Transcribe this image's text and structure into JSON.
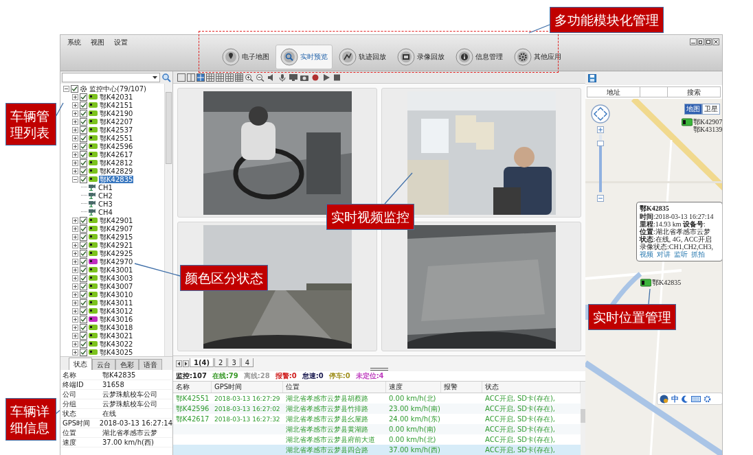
{
  "menu": [
    "系统",
    "视图",
    "设置"
  ],
  "modules": [
    {
      "label": "电子地图",
      "selected": false
    },
    {
      "label": "实时预览",
      "selected": true
    },
    {
      "label": "轨迹回放",
      "selected": false
    },
    {
      "label": "录像回放",
      "selected": false
    },
    {
      "label": "信息管理",
      "selected": false
    },
    {
      "label": "其他应用",
      "selected": false
    }
  ],
  "tree": {
    "label": "监控中心(79/107)",
    "checked": true,
    "expanded": true,
    "children": [
      {
        "label": "鄂K42031",
        "checked": true,
        "expanded": false,
        "selected": false,
        "color": "#7cc21e"
      },
      {
        "label": "鄂K42151",
        "checked": true,
        "expanded": false,
        "selected": false,
        "color": "#7cc21e"
      },
      {
        "label": "鄂K42190",
        "checked": true,
        "expanded": false,
        "selected": false,
        "color": "#7cc21e"
      },
      {
        "label": "鄂K42207",
        "checked": true,
        "expanded": false,
        "selected": false,
        "color": "#7cc21e"
      },
      {
        "label": "鄂K42537",
        "checked": true,
        "expanded": false,
        "selected": false,
        "color": "#7cc21e"
      },
      {
        "label": "鄂K42551",
        "checked": true,
        "expanded": false,
        "selected": false,
        "color": "#7cc21e"
      },
      {
        "label": "鄂K42596",
        "checked": true,
        "expanded": false,
        "selected": false,
        "color": "#7cc21e"
      },
      {
        "label": "鄂K42617",
        "checked": true,
        "expanded": false,
        "selected": false,
        "color": "#7cc21e"
      },
      {
        "label": "鄂K42812",
        "checked": true,
        "expanded": false,
        "selected": false,
        "color": "#7cc21e"
      },
      {
        "label": "鄂K42829",
        "checked": true,
        "expanded": false,
        "selected": false,
        "color": "#7cc21e"
      },
      {
        "label": "鄂K42835",
        "checked": true,
        "expanded": true,
        "selected": true,
        "color": "#7cc21e",
        "children": [
          {
            "label": "CH1"
          },
          {
            "label": "CH2"
          },
          {
            "label": "CH3"
          },
          {
            "label": "CH4"
          }
        ]
      },
      {
        "label": "鄂K42901",
        "checked": true,
        "expanded": false,
        "selected": false,
        "color": "#7cc21e"
      },
      {
        "label": "鄂K42907",
        "checked": true,
        "expanded": false,
        "selected": false,
        "color": "#7cc21e"
      },
      {
        "label": "鄂K42915",
        "checked": true,
        "expanded": false,
        "selected": false,
        "color": "#7cc21e"
      },
      {
        "label": "鄂K42921",
        "checked": true,
        "expanded": false,
        "selected": false,
        "color": "#7cc21e"
      },
      {
        "label": "鄂K42925",
        "checked": true,
        "expanded": false,
        "selected": false,
        "color": "#7cc21e"
      },
      {
        "label": "鄂K42970",
        "checked": true,
        "expanded": false,
        "selected": false,
        "color": "#c02ec0"
      },
      {
        "label": "鄂K43001",
        "checked": true,
        "expanded": false,
        "selected": false,
        "color": "#7cc21e"
      },
      {
        "label": "鄂K43003",
        "checked": true,
        "expanded": false,
        "selected": false,
        "color": "#7cc21e"
      },
      {
        "label": "鄂K43007",
        "checked": true,
        "expanded": false,
        "selected": false,
        "color": "#7cc21e"
      },
      {
        "label": "鄂K43010",
        "checked": true,
        "expanded": false,
        "selected": false,
        "color": "#7cc21e"
      },
      {
        "label": "鄂K43011",
        "checked": true,
        "expanded": false,
        "selected": false,
        "color": "#7cc21e"
      },
      {
        "label": "鄂K43012",
        "checked": true,
        "expanded": false,
        "selected": false,
        "color": "#7cc21e"
      },
      {
        "label": "鄂K43016",
        "checked": true,
        "expanded": false,
        "selected": false,
        "color": "#c02ec0"
      },
      {
        "label": "鄂K43018",
        "checked": true,
        "expanded": false,
        "selected": false,
        "color": "#7cc21e"
      },
      {
        "label": "鄂K43021",
        "checked": true,
        "expanded": false,
        "selected": false,
        "color": "#7cc21e"
      },
      {
        "label": "鄂K43022",
        "checked": true,
        "expanded": false,
        "selected": false,
        "color": "#7cc21e"
      },
      {
        "label": "鄂K43025",
        "checked": true,
        "expanded": false,
        "selected": false,
        "color": "#7cc21e"
      }
    ]
  },
  "detail_tabs": [
    {
      "label": "状态",
      "selected": true
    },
    {
      "label": "云台",
      "selected": false
    },
    {
      "label": "色彩",
      "selected": false
    },
    {
      "label": "语音",
      "selected": false
    }
  ],
  "detail_rows": [
    {
      "label": "名称",
      "value": "鄂K42835"
    },
    {
      "label": "终端ID",
      "value": "31658"
    },
    {
      "label": "公司",
      "value": "云梦珠航校车公司"
    },
    {
      "label": "分组",
      "value": "云梦珠航校车公司"
    },
    {
      "label": "状态",
      "value": "在线"
    },
    {
      "label": "GPS时间",
      "value": "2018-03-13 16:27:14"
    },
    {
      "label": "位置",
      "value": "湖北省孝感市云梦"
    },
    {
      "label": "速度",
      "value": "37.00 km/h(西)"
    }
  ],
  "video_tiles": [
    {
      "kind": "picture"
    },
    {
      "kind": "picture"
    },
    {
      "kind": "picture"
    },
    {
      "kind": "picture"
    }
  ],
  "page_tabs": [
    {
      "label": "1(4)",
      "selected": true
    },
    {
      "label": "2",
      "selected": false
    },
    {
      "label": "3",
      "selected": false
    },
    {
      "label": "4",
      "selected": false
    }
  ],
  "counts": [
    {
      "text": "监控:107",
      "color": "#222222"
    },
    {
      "text": "在线:79",
      "color": "#3a9a2a"
    },
    {
      "text": "离线:28",
      "color": "#9a9a9a"
    },
    {
      "text": "报警:0",
      "color": "#d02020"
    },
    {
      "text": "怠速:0",
      "color": "#1a1a50"
    },
    {
      "text": "停车:0",
      "color": "#a09020"
    },
    {
      "text": "未定位:4",
      "color": "#c040c0"
    }
  ],
  "table": {
    "columns": [
      "名称",
      "GPS时间",
      "位置",
      "速度",
      "报警",
      "状态"
    ],
    "rows": [
      {
        "name": "鄂K42551",
        "gps_time": "2018-03-13 16:27:29",
        "location": "湖北省孝感市云梦县胡蔡路",
        "speed": "0.00 km/h(北)",
        "status": "ACC开启, SD卡(存在),",
        "selected": false
      },
      {
        "name": "鄂K42596",
        "gps_time": "2018-03-13 16:27:02",
        "location": "湖北省孝感市云梦县竹排路",
        "speed": "23.00 km/h(南)",
        "status": "ACC开启, SD卡(存在),",
        "selected": false
      },
      {
        "name": "鄂K42617",
        "gps_time": "2018-03-13 16:27:32",
        "location": "湖北省孝感市云梦县幺屋路",
        "speed": "24.00 km/h(东)",
        "status": "ACC开启, SD卡(存在),",
        "selected": false
      },
      {
        "location": "湖北省孝感市云梦县黄湖路",
        "speed": "0.00 km/h(南)",
        "status": "ACC开启, SD卡(存在),",
        "selected": false
      },
      {
        "location": "湖北省孝感市云梦县府前大道",
        "speed": "0.00 km/h(北)",
        "status": "ACC开启, SD卡(存在),",
        "selected": false
      },
      {
        "location": "湖北省孝感市云梦县四合路",
        "speed": "37.00 km/h(西)",
        "status": "ACC开启, SD卡(存在),",
        "selected": true
      }
    ]
  },
  "map": {
    "kind": "picture",
    "search_label": "地址",
    "search_button": "搜索",
    "map_types": [
      {
        "label": "地图",
        "selected": true
      },
      {
        "label": "卫星",
        "selected": false
      }
    ],
    "zoom": {
      "level": 0.85
    },
    "markers": [
      {
        "labels": [
          "鄂K42907",
          "鄂K43139"
        ]
      },
      {
        "labels": [
          "鄂K42835"
        ]
      }
    ],
    "popup": {
      "title": "鄂K42835",
      "lines": [
        "**时间**:2018-03-13 16:27:14",
        "**里程**:14.93 km **设备号**:",
        "**位置**:湖北省孝感市云梦",
        "**状态**:在线, 4G, ACC开启",
        "录像状态:CH1,CH2,CH3,"
      ],
      "links": [
        "视频",
        "对讲",
        "监听",
        "抓拍"
      ]
    },
    "ime": "中"
  },
  "callouts": [
    {
      "text": "多功能模块化管理"
    },
    {
      "text": "车辆管理列表"
    },
    {
      "text": "颜色区分状态"
    },
    {
      "text": "实时视频监控"
    },
    {
      "text": "实时位置管理"
    },
    {
      "text": "车辆详细信息"
    }
  ]
}
